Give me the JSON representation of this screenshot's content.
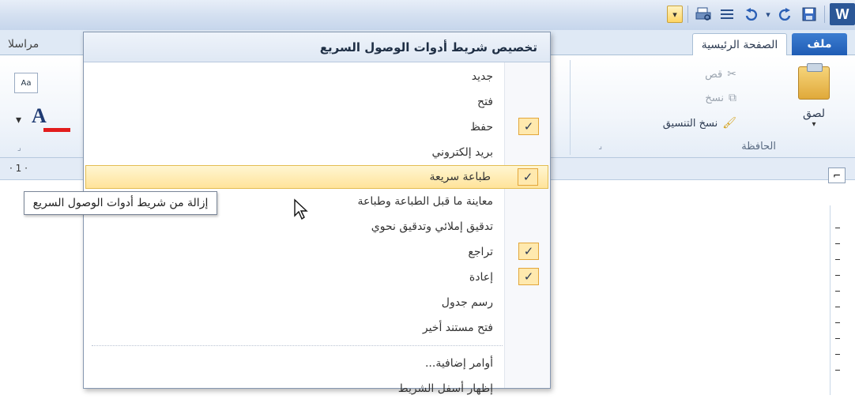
{
  "titlebar": {
    "app_logo": "W",
    "qat_icons": [
      "customize-dropdown-icon",
      "print-preview-icon",
      "paragraph-lines-icon",
      "undo-icon",
      "redo-icon",
      "save-icon"
    ],
    "customize_glyph": "▾"
  },
  "tabs": {
    "file": "ملف",
    "home": "الصفحة الرئيسية",
    "mailings": "مراسلا"
  },
  "ribbon": {
    "paste_label": "لصق",
    "cut_label": "قص",
    "copy_label": "نسخ",
    "format_painter_label": "نسخ التنسيق",
    "clipboard_group": "الحافظة"
  },
  "ruler": {
    "number": "· 1 ·"
  },
  "menu": {
    "title": "تخصيص شريط أدوات الوصول السريع",
    "items": [
      {
        "label": "جديد",
        "checked": false
      },
      {
        "label": "فتح",
        "checked": false
      },
      {
        "label": "حفظ",
        "checked": true
      },
      {
        "label": "بريد إلكتروني",
        "checked": false
      },
      {
        "label": "طباعة سريعة",
        "checked": true,
        "highlighted": true
      },
      {
        "label": "معاينة ما قبل الطباعة وطباعة",
        "checked": false
      },
      {
        "label": "تدقيق إملائي وتدقيق نحوي",
        "checked": false
      },
      {
        "label": "تراجع",
        "checked": true
      },
      {
        "label": "إعادة",
        "checked": true
      },
      {
        "label": "رسم جدول",
        "checked": false
      },
      {
        "label": "فتح مستند أخير",
        "checked": false
      }
    ],
    "more_commands": "أوامر إضافية...",
    "show_below": "إظهار أسفل الشريط",
    "check_glyph": "✓"
  },
  "tooltip": {
    "text": "إزالة من شريط أدوات الوصول السريع"
  }
}
